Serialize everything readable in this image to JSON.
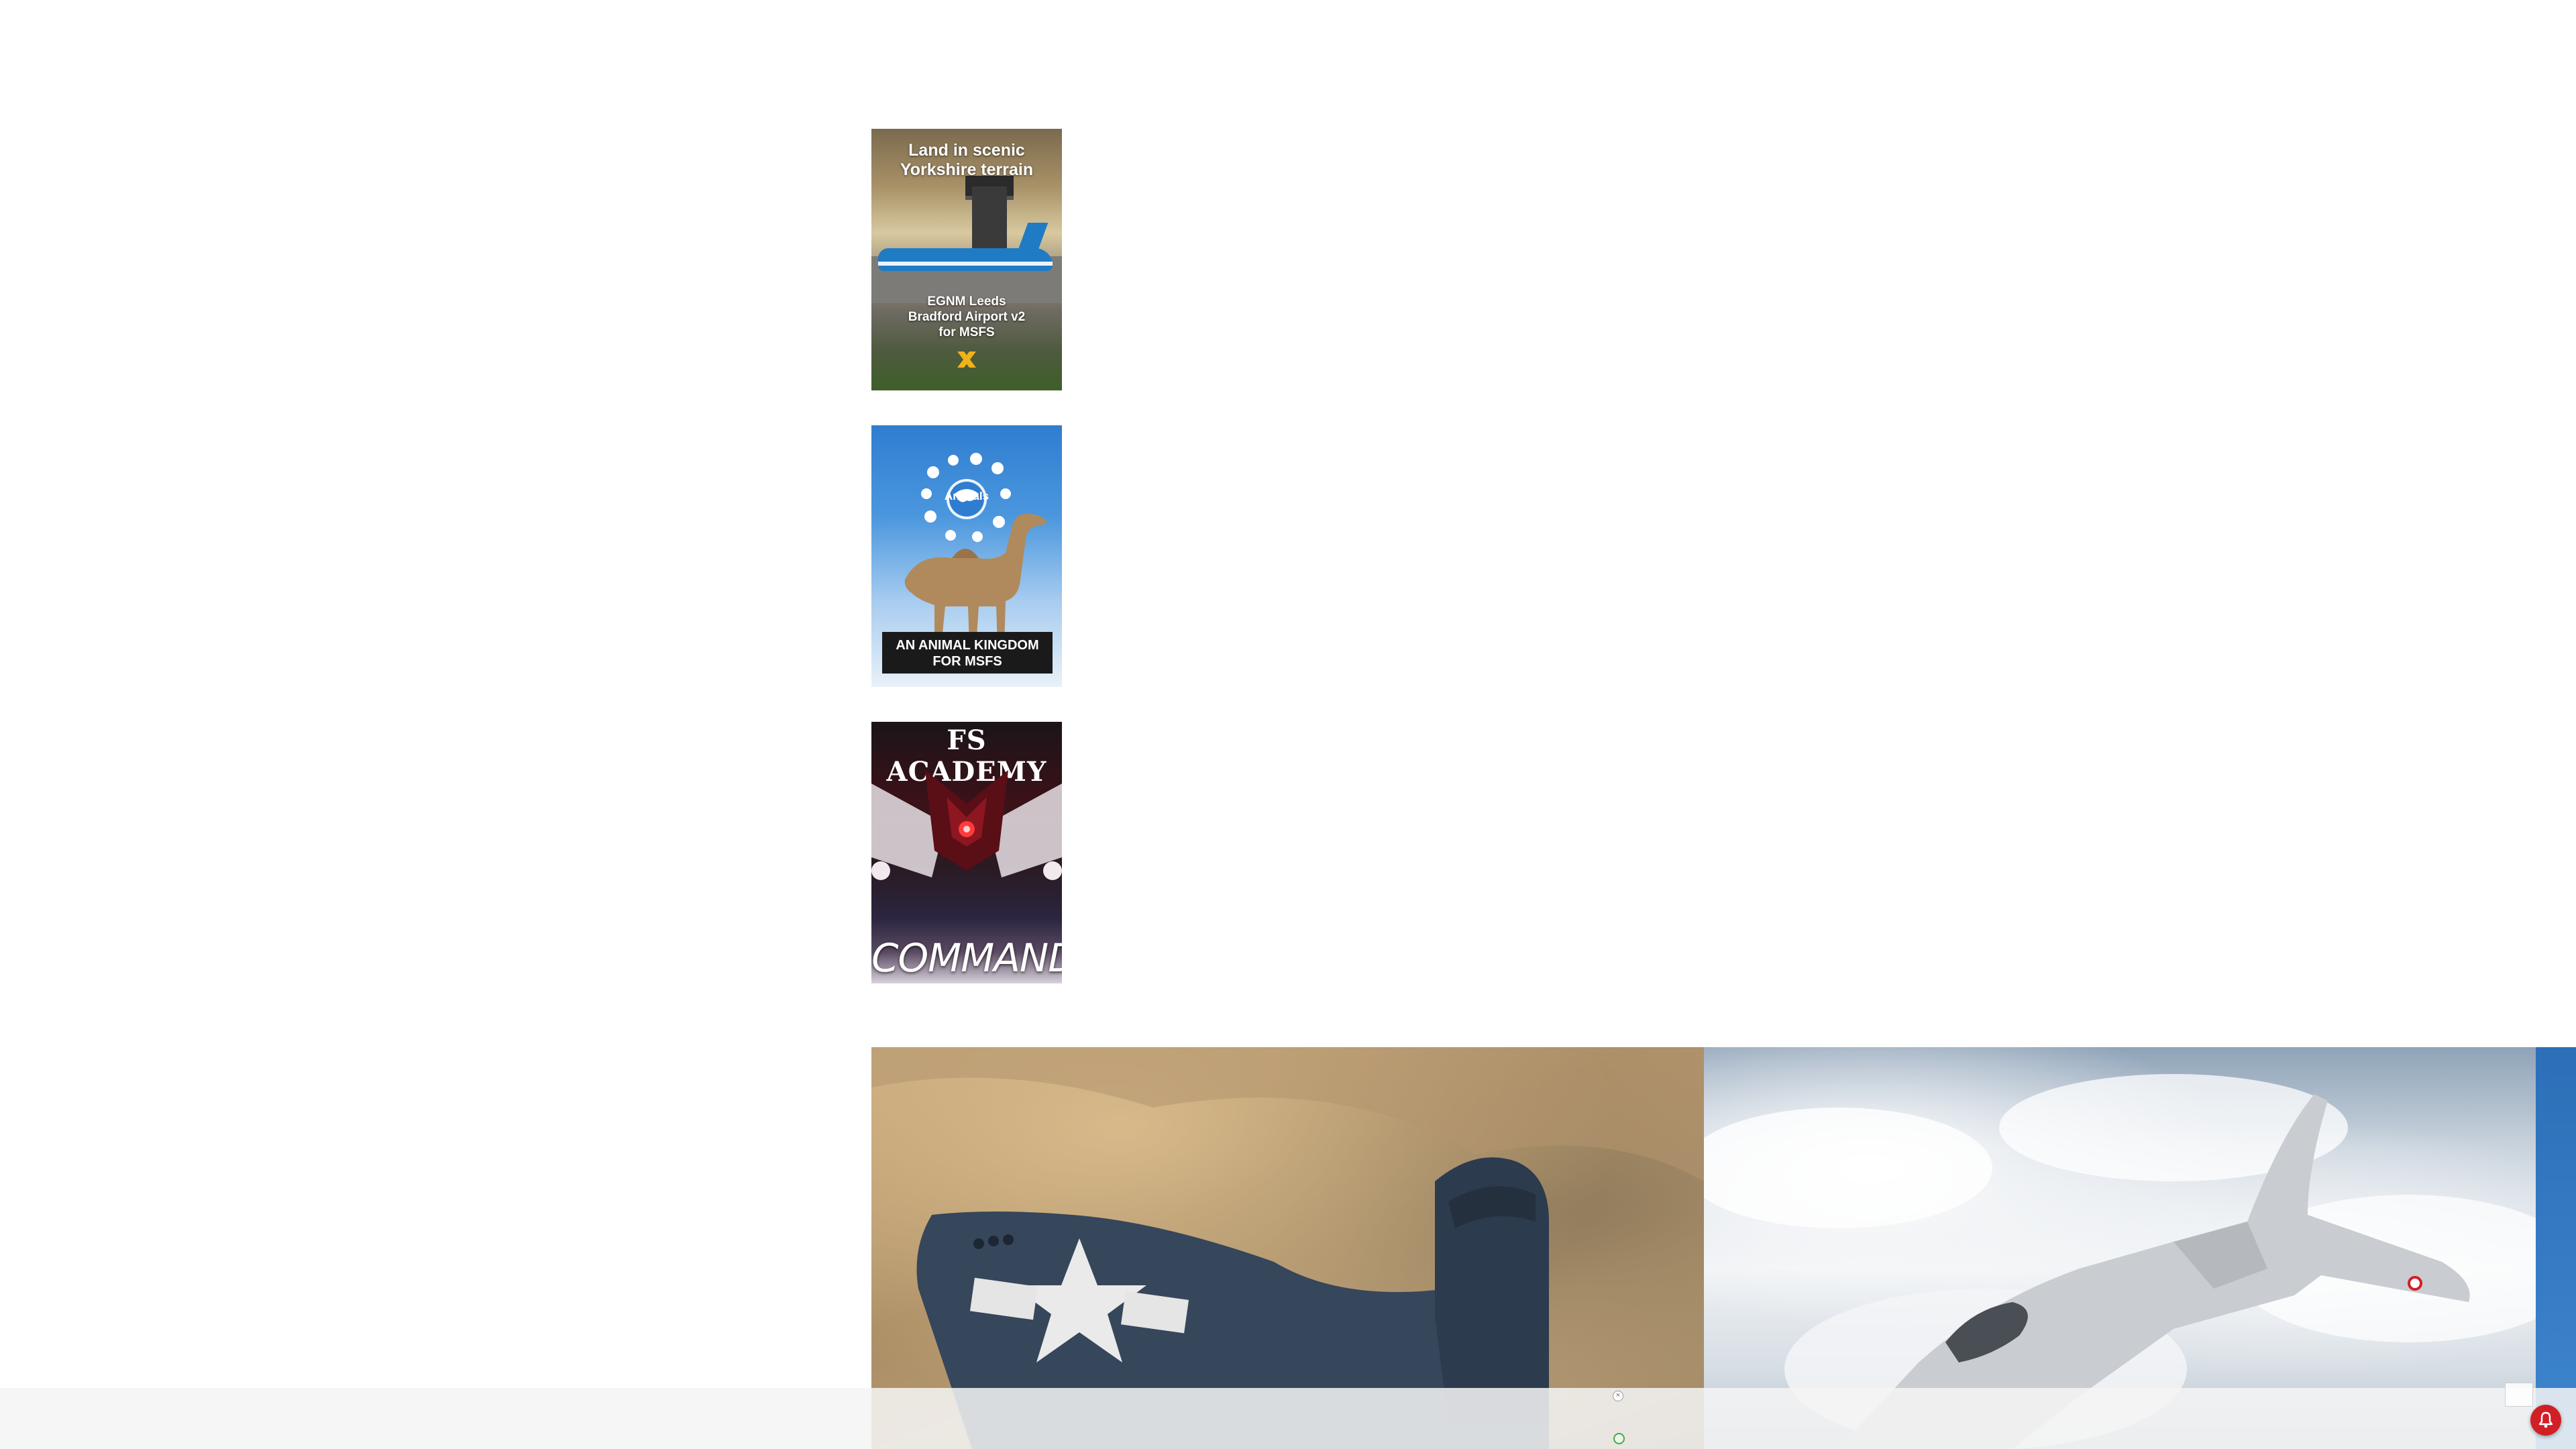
{
  "sidebar_ads": [
    {
      "headline": "Land in scenic\nYorkshire terrain",
      "caption": "EGNM Leeds\nBradford Airport v2\nfor MSFS",
      "logo_icon": "x-logo-icon"
    },
    {
      "emblem_text": "Animals",
      "label": "AN ANIMAL KINGDOM\nFOR MSFS"
    },
    {
      "brand": "FS ACADEMY",
      "title": "COMMANDER"
    }
  ],
  "gallery": {
    "slides": [
      {
        "subject": "navy-corsair-over-desert"
      },
      {
        "subject": "rafale-jet-above-clouds"
      },
      {
        "subject": "partial-blue-slide"
      }
    ]
  },
  "bottom_bar": {
    "close_icon": "close-icon",
    "info_icon": "ad-choices-icon",
    "notification_icon": "bell-icon"
  },
  "colors": {
    "page_background": "#ffffff",
    "bell_red": "#d11f26",
    "ad2_blue": "#2f7dd0",
    "ad1_plane_blue": "#1f7bc4"
  }
}
